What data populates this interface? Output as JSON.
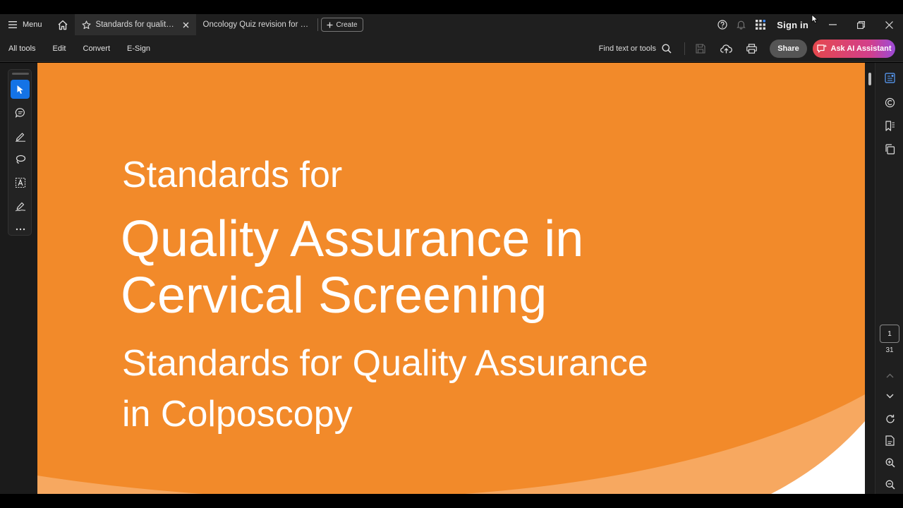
{
  "tabbar": {
    "menu_label": "Menu",
    "tabs": [
      {
        "label": "Standards for quality ass...",
        "active": true
      },
      {
        "label": "Oncology Quiz  revision for part..."
      }
    ],
    "create_label": "Create",
    "signin_label": "Sign in"
  },
  "toolbar": {
    "menus": [
      "All tools",
      "Edit",
      "Convert",
      "E-Sign"
    ],
    "find_label": "Find text or tools",
    "share_label": "Share",
    "ai_label": "Ask AI Assistant"
  },
  "document": {
    "line1": "Standards for",
    "line2": "Quality Assurance in",
    "line3": "Cervical Screening",
    "line4": "Standards for Quality Assurance",
    "line5": "in Colposcopy",
    "background_color": "#f28a2a",
    "text_color": "#ffffff"
  },
  "pagination": {
    "current_page": "1",
    "total_pages": "31"
  },
  "colors": {
    "chrome": "#1f1f1f",
    "accent_blue": "#1473e6",
    "ai_gradient_start": "#e5484d",
    "ai_gradient_end": "#9b4bd8"
  }
}
